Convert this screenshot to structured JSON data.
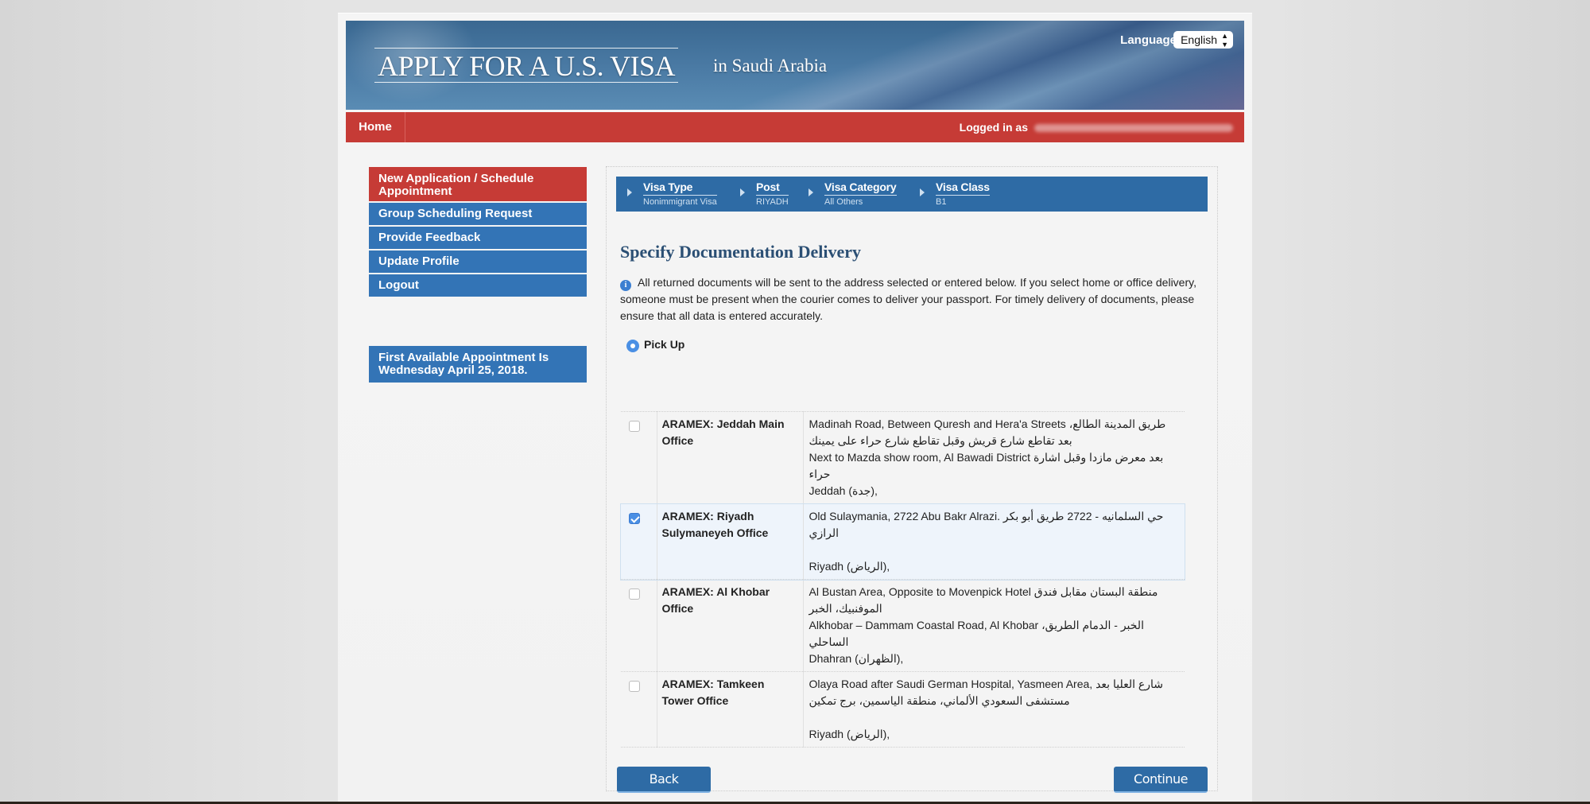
{
  "banner": {
    "title": "APPLY FOR A U.S. VISA",
    "subtitle": "in  Saudi Arabia",
    "language_label": "Language:",
    "language_value": "English"
  },
  "navbar": {
    "home": "Home",
    "logged_in_label": "Logged in as"
  },
  "sidebar": {
    "items": [
      {
        "label": "New Application / Schedule Appointment",
        "active": true
      },
      {
        "label": "Group Scheduling Request"
      },
      {
        "label": "Provide Feedback"
      },
      {
        "label": "Update Profile"
      },
      {
        "label": "Logout"
      }
    ],
    "notice": "First Available Appointment Is Wednesday April 25, 2018."
  },
  "breadcrumbs": [
    {
      "title": "Visa Type",
      "value": "Nonimmigrant Visa"
    },
    {
      "title": "Post",
      "value": "RIYADH"
    },
    {
      "title": "Visa Category",
      "value": "All Others"
    },
    {
      "title": "Visa Class",
      "value": "B1"
    }
  ],
  "main": {
    "title": "Specify Documentation Delivery",
    "info": "All returned documents will be sent to the address selected or entered below. If you select home or office delivery, someone must be present when the courier comes to deliver your passport. For timely delivery of documents, please ensure that all data is entered accurately.",
    "pickup_label": "Pick Up",
    "pickup_selected": true,
    "offices": [
      {
        "name": "ARAMEX: Jeddah Main Office",
        "checked": false,
        "lines": [
          "Madinah Road, Between Quresh and Hera'a Streets طريق المدينة الطالع، بعد تقاطع شارع قريش وقبل تقاطع شارع حراء على يمينك",
          "Next to Mazda show room, Al Bawadi District بعد معرض مازدا وقبل اشارة حراء",
          "Jeddah (جدة),"
        ]
      },
      {
        "name": "ARAMEX: Riyadh Sulymaneyeh Office",
        "checked": true,
        "lines": [
          "Old Sulaymania, 2722 Abu Bakr Alrazi. حي السلمانيه - 2722 طريق أبو بكر الرازي",
          "",
          "Riyadh (الرياض),"
        ]
      },
      {
        "name": "ARAMEX: Al Khobar Office",
        "checked": false,
        "lines": [
          "Al Bustan Area, Opposite to Movenpick Hotel منطقة البستان مقابل فندق الموفنبيك، الخبر",
          "Alkhobar – Dammam Coastal Road, Al Khobar الخبر - الدمام الطريق، الساحلي",
          "Dhahran (الظهران),"
        ]
      },
      {
        "name": "ARAMEX: Tamkeen Tower Office",
        "checked": false,
        "lines": [
          "Olaya Road after Saudi German Hospital, Yasmeen Area, شارع العليا بعد مستشفى السعودي الألماني، منطقة الياسمين، برج تمكين",
          "",
          "Riyadh (الرياض),"
        ]
      }
    ]
  },
  "buttons": {
    "back": "Back",
    "continue": "Continue"
  },
  "colors": {
    "nav_red": "#c63b36",
    "menu_blue": "#3374b6",
    "crumb_blue": "#2e6ba5",
    "title_blue": "#2b4f74",
    "check_blue": "#4a8fe4"
  }
}
